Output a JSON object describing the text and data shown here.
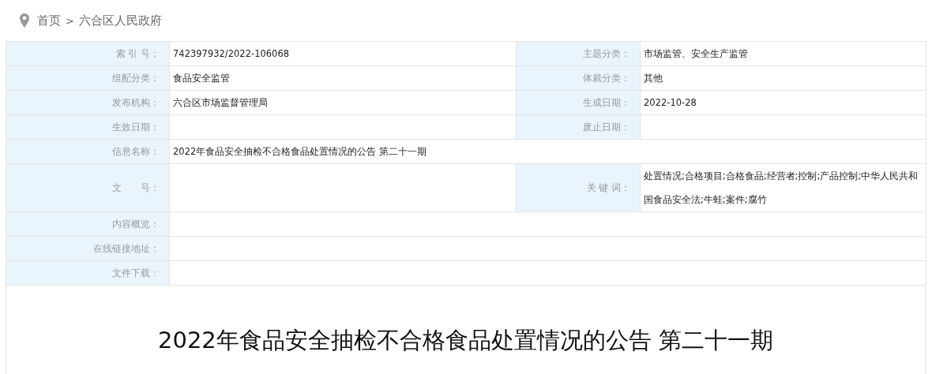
{
  "breadcrumb": {
    "items": [
      "首页",
      "六合区人民政府"
    ],
    "separator": ">"
  },
  "meta_table": {
    "rows": [
      {
        "cells": [
          {
            "label": "索 引 号：",
            "value": "742397932/2022-106068"
          },
          {
            "label": "主题分类：",
            "value": "市场监管、安全生产监管"
          }
        ]
      },
      {
        "cells": [
          {
            "label": "组配分类：",
            "value": "食品安全监管"
          },
          {
            "label": "体裁分类：",
            "value": "其他"
          }
        ]
      },
      {
        "cells": [
          {
            "label": "发布机构：",
            "value": "六合区市场监督管理局"
          },
          {
            "label": "生成日期：",
            "value": "2022-10-28"
          }
        ]
      },
      {
        "cells": [
          {
            "label": "生效日期："
          },
          {
            "label": "废止日期："
          }
        ]
      },
      {
        "cells": [
          {
            "label": "信息名称：",
            "value": "2022年食品安全抽检不合格食品处置情况的公告 第二十一期"
          }
        ]
      },
      {
        "cells": [
          {
            "label": "文　　号："
          },
          {
            "label": "关 键 词：",
            "value": " 处置情况;合格项目;合格食品;经营者;控制;产品控制;中华人民共和国食品安全法;牛蛙;案件;腐竹"
          }
        ]
      },
      {
        "cells": [
          {
            "label": "内容概览："
          }
        ]
      },
      {
        "cells": [
          {
            "label": "在线链接地址："
          }
        ]
      },
      {
        "cells": [
          {
            "label": "文件下载："
          }
        ]
      }
    ]
  },
  "article": {
    "title": "2022年食品安全抽检不合格食品处置情况的公告 第二十一期"
  }
}
